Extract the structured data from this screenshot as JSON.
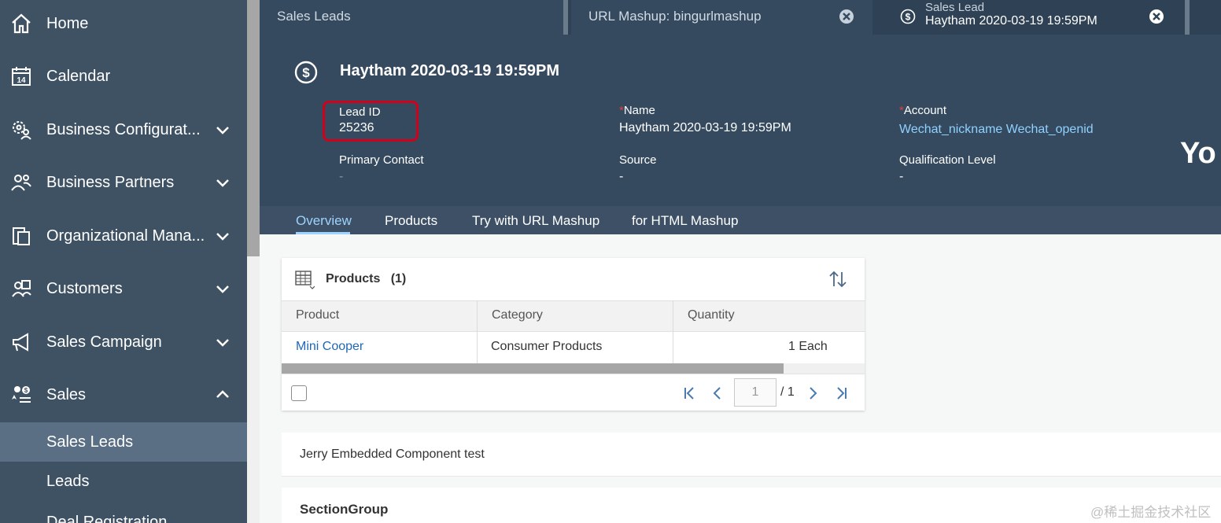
{
  "sidebar": {
    "items": [
      {
        "label": "Home",
        "icon": "home-icon"
      },
      {
        "label": "Calendar",
        "icon": "calendar-icon",
        "icon_text": "14"
      },
      {
        "label": "Business Configurat...",
        "icon": "settings-user-icon"
      },
      {
        "label": "Business Partners",
        "icon": "partners-icon"
      },
      {
        "label": "Organizational Mana...",
        "icon": "organization-icon"
      },
      {
        "label": "Customers",
        "icon": "customers-icon"
      },
      {
        "label": "Sales Campaign",
        "icon": "megaphone-icon"
      },
      {
        "label": "Sales",
        "icon": "sales-icon"
      }
    ],
    "sub_items": [
      {
        "label": "Sales Leads"
      },
      {
        "label": "Leads"
      },
      {
        "label": "Deal Registration"
      }
    ]
  },
  "tabs": [
    {
      "label": "Sales Leads"
    },
    {
      "label": "URL Mashup: bingurlmashup"
    },
    {
      "label_top": "Sales Lead",
      "label_main": "Haytham 2020-03-19 19:59PM"
    }
  ],
  "header": {
    "title": "Haytham 2020-03-19 19:59PM",
    "fields": {
      "lead_id": {
        "label": "Lead ID",
        "value": "25236"
      },
      "name": {
        "required_mark": "*",
        "label": "Name",
        "value": "Haytham 2020-03-19 19:59PM"
      },
      "account": {
        "required_mark": "*",
        "label": "Account",
        "value": "Wechat_nickname Wechat_openid"
      },
      "primary_contact": {
        "label": "Primary Contact",
        "value": "-"
      },
      "source": {
        "label": "Source",
        "value": "-"
      },
      "qualification": {
        "label": "Qualification Level",
        "value": "-"
      }
    },
    "side_text": "Yo"
  },
  "subtabs": [
    {
      "label": "Overview"
    },
    {
      "label": "Products"
    },
    {
      "label": "Try with URL Mashup"
    },
    {
      "label": "for HTML Mashup"
    }
  ],
  "products": {
    "title": "Products",
    "count": "(1)",
    "columns": [
      "Product",
      "Category",
      "Quantity"
    ],
    "rows": [
      {
        "product": "Mini Cooper",
        "category": "Consumer Products",
        "quantity": "1 Each"
      }
    ],
    "pager": {
      "page": "1",
      "total": "/ 1"
    }
  },
  "panels": {
    "embedded": "Jerry Embedded Component test",
    "section_group": "SectionGroup"
  },
  "watermark": "@稀土掘金技术社区",
  "colors": {
    "sidebar_bg": "#3f5264",
    "header_bg": "#354a5f",
    "accent_link": "#8fd1ff",
    "highlight_box": "#d0021b"
  }
}
